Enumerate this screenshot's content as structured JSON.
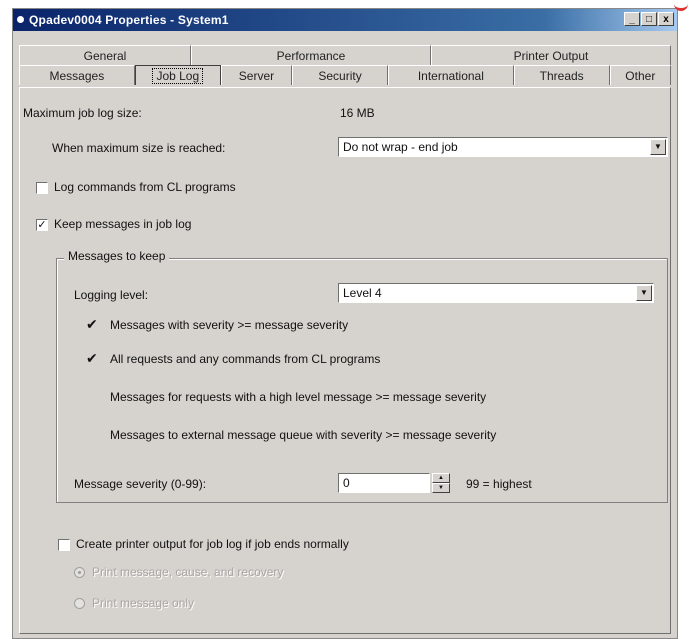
{
  "window": {
    "title": "Qpadev0004 Properties - System1",
    "min_label": "_",
    "max_label": "□",
    "close_label": "x"
  },
  "tabs": {
    "row_back": [
      "General",
      "Performance",
      "Printer Output"
    ],
    "row_front": [
      "Messages",
      "Job Log",
      "Server",
      "Security",
      "International",
      "Threads",
      "Other"
    ],
    "active": "Job Log"
  },
  "job_log": {
    "max_size_label": "Maximum job log size:",
    "max_size_value": "16 MB",
    "when_reached_label": "When maximum size is reached:",
    "when_reached_value": "Do not wrap - end job",
    "log_cl_label": "Log commands from CL programs",
    "log_cl_checked": false,
    "keep_messages_label": "Keep messages in job log",
    "keep_messages_checked": true,
    "group_title": "Messages to keep",
    "logging_level_label": "Logging level:",
    "logging_level_value": "Level 4",
    "options": [
      {
        "text": "Messages with severity >= message severity",
        "checked": true
      },
      {
        "text": "All requests and any commands from CL programs",
        "checked": true
      },
      {
        "text": "Messages for requests with a high level message >= message severity",
        "checked": false
      },
      {
        "text": "Messages to external message queue with severity >= message severity",
        "checked": false
      }
    ],
    "severity_label": "Message severity (0-99):",
    "severity_value": "0",
    "severity_hint": "99 = highest",
    "printer_output_label": "Create printer output for job log if job ends normally",
    "printer_output_checked": false,
    "radio_1_label": "Print message, cause, and recovery",
    "radio_2_label": "Print message only"
  },
  "colors": {
    "titlebar_start": "#0a246a",
    "face": "#d6d3ce"
  }
}
